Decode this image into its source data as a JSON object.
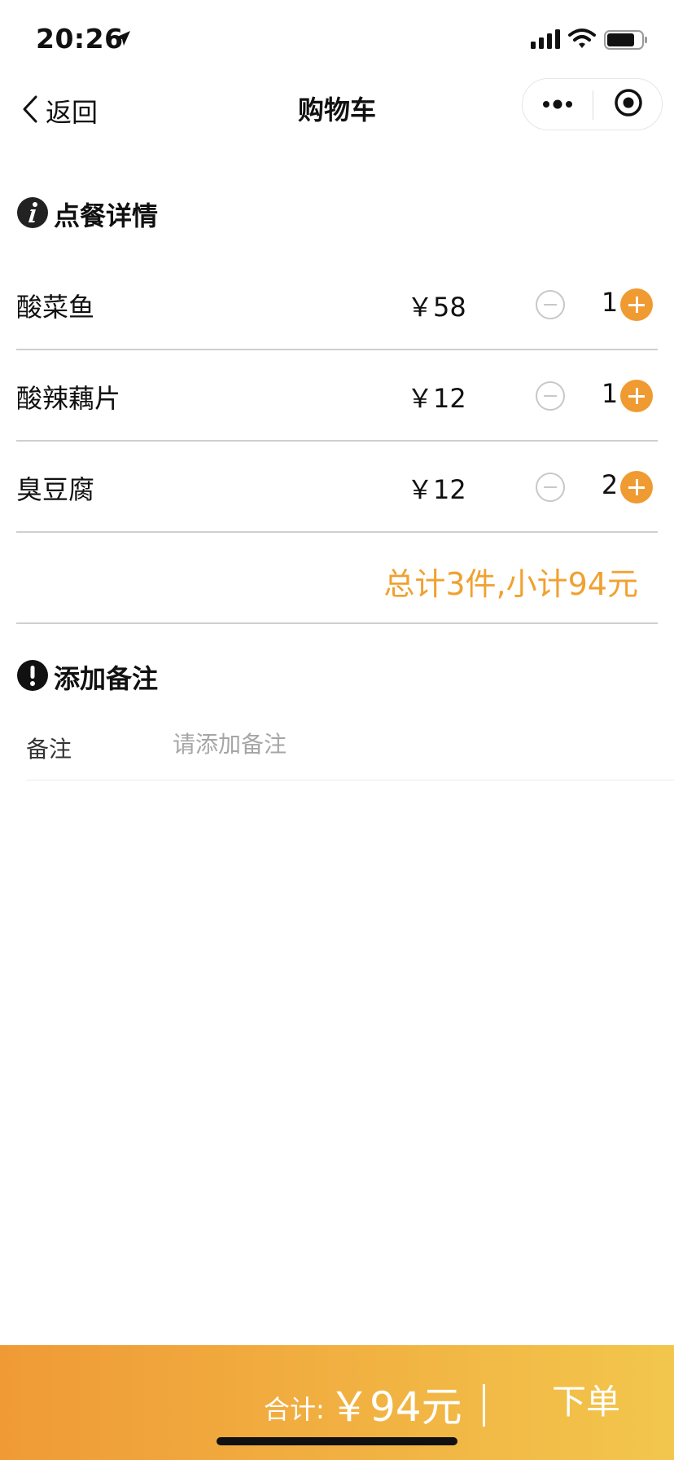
{
  "status_bar": {
    "time": "20:26"
  },
  "nav": {
    "back_label": "返回",
    "title": "购物车"
  },
  "sections": {
    "details_title": "点餐详情",
    "remark_title": "添加备注"
  },
  "items": [
    {
      "name": "酸菜鱼",
      "price": "￥58",
      "qty": "1"
    },
    {
      "name": "酸辣藕片",
      "price": "￥12",
      "qty": "1"
    },
    {
      "name": "臭豆腐",
      "price": "￥12",
      "qty": "2"
    }
  ],
  "subtotal": "总计3件,小计94元",
  "remark": {
    "label": "备注",
    "placeholder": "请添加备注",
    "value": ""
  },
  "bottom_bar": {
    "total_label": "合计:",
    "total_value": "￥94元",
    "order_label": "下单"
  },
  "colors": {
    "accent": "#f09a32",
    "subtotal_text": "#f0a130",
    "gradient_start": "#f09a36",
    "gradient_end": "#f2c64c"
  }
}
